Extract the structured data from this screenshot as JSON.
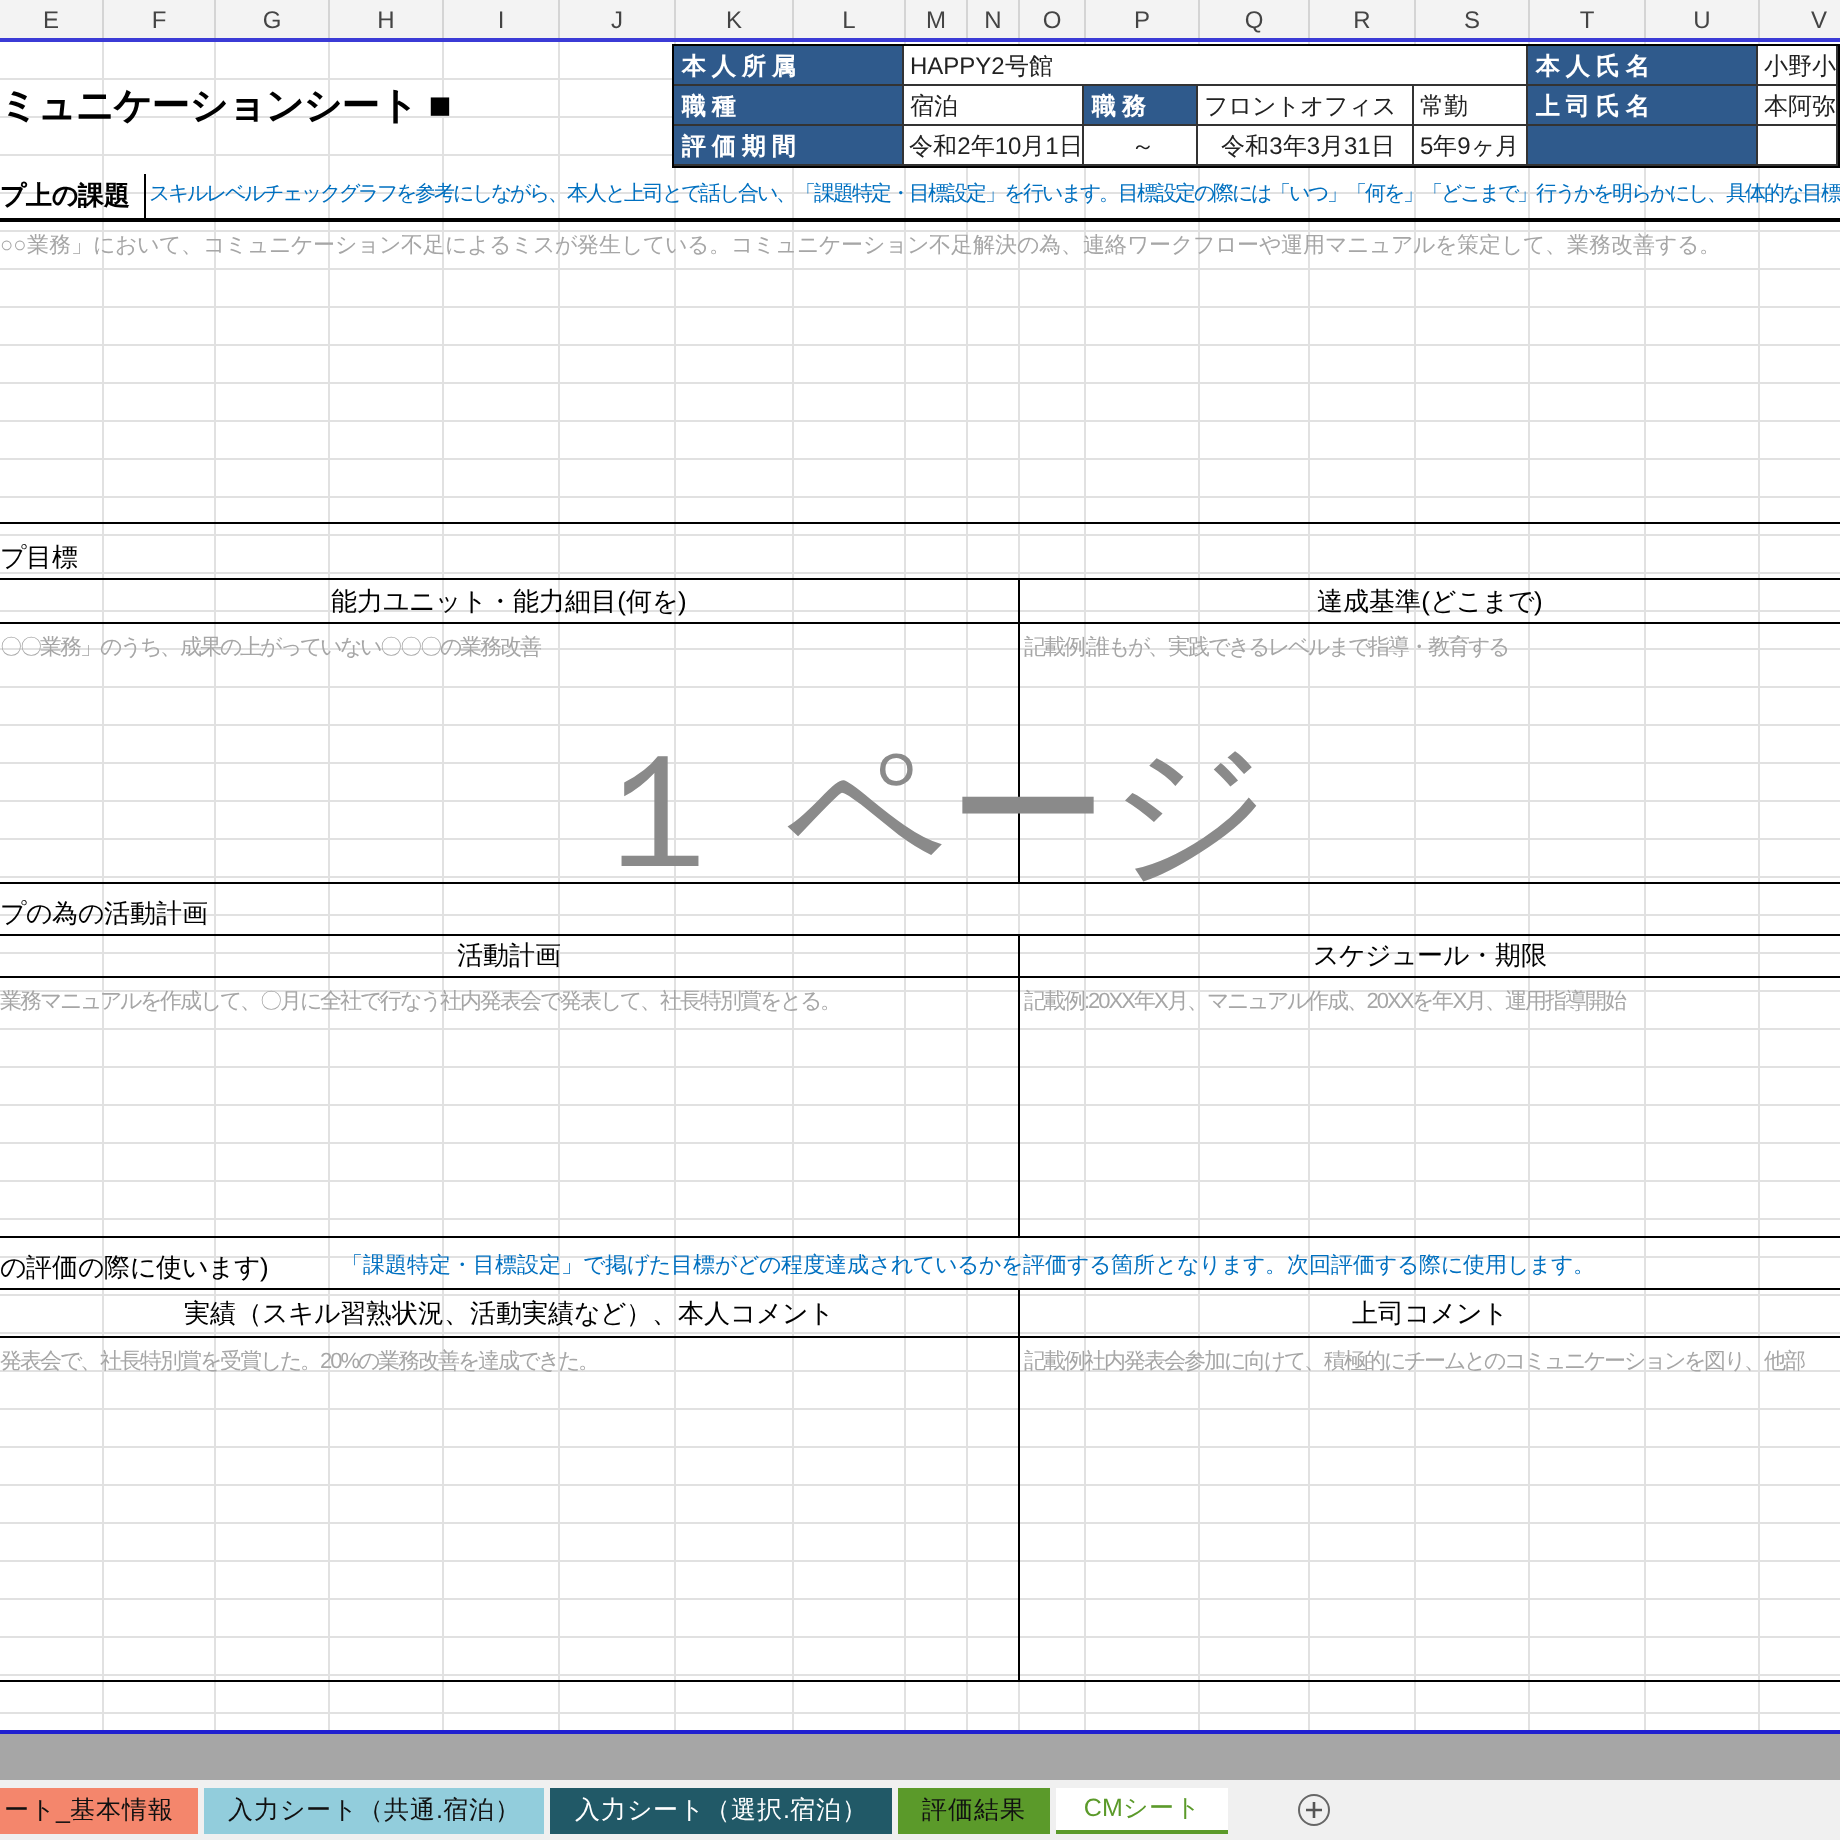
{
  "column_headers": [
    "E",
    "F",
    "G",
    "H",
    "I",
    "J",
    "K",
    "L",
    "M",
    "N",
    "O",
    "P",
    "Q",
    "R",
    "S",
    "T",
    "U",
    "V"
  ],
  "title": "ミュニケーションシート ■",
  "info_table": [
    {
      "cells": [
        {
          "kind": "label",
          "text": "本人所属"
        },
        {
          "kind": "value",
          "text": "HAPPY2号館"
        },
        {
          "kind": "label",
          "text": "本人氏名"
        },
        {
          "kind": "value",
          "text": "小野小"
        }
      ]
    },
    {
      "cells": [
        {
          "kind": "label",
          "text": "職種"
        },
        {
          "kind": "value",
          "text": "宿泊"
        },
        {
          "kind": "label",
          "text": "職務"
        },
        {
          "kind": "value",
          "text": "フロントオフィス"
        },
        {
          "kind": "value",
          "text": "常勤"
        },
        {
          "kind": "label",
          "text": "上司氏名"
        },
        {
          "kind": "value",
          "text": "本阿弥"
        }
      ]
    },
    {
      "cells": [
        {
          "kind": "label",
          "text": "評価期間"
        },
        {
          "kind": "value",
          "text": "令和2年10月1日"
        },
        {
          "kind": "value",
          "text": "～"
        },
        {
          "kind": "value",
          "text": "令和3年3月31日"
        },
        {
          "kind": "value",
          "text": "5年9ヶ月"
        },
        {
          "kind": "label"
        },
        {
          "kind": "value"
        }
      ]
    }
  ],
  "sections": [
    {
      "kind": "single",
      "title": "プ上の課題",
      "note": "スキルレベルチェックグラフを参考にしながら、本人と上司とで話し合い、「課題特定・目標設定」を行います。目標設定の際には「いつ」「何を」「どこまで」行うかを明らかにし、具体的な目標",
      "text": "○○業務」において、コミュニケーション不足によるミスが発生している。コミュニケーション不足解決の為、連絡ワークフローや運用マニュアルを策定して、業務改善する。"
    },
    {
      "kind": "split",
      "title": "プ目標",
      "columns": [
        {
          "heading": "能力ユニット・能力細目(何を)",
          "text": "〇〇業務」のうち、成果の上がっていない〇〇〇の業務改善"
        },
        {
          "heading": "達成基準(どこまで)",
          "text": "記載例:誰もが、実践できるレベルまで指導・教育する"
        }
      ]
    },
    {
      "kind": "split",
      "title": "プの為の活動計画",
      "columns": [
        {
          "heading": "活動計画",
          "text": "業務マニュアルを作成して、〇月に全社で行なう社内発表会で発表して、社長特別賞をとる。"
        },
        {
          "heading": "スケジュール・期限",
          "text": "記載例:20XX年X月、マニュアル作成、20XXを年X月、運用指導開始"
        }
      ]
    },
    {
      "kind": "split",
      "title": "の評価の際に使います)",
      "note": "「課題特定・目標設定」で掲げた目標がどの程度達成されているかを評価する箇所となります。次回評価する際に使用します。",
      "columns": [
        {
          "heading": "実績（スキル習熟状況、活動実績など）、本人コメント",
          "text": "発表会で、社長特別賞を受賞した。20%の業務改善を達成できた。"
        },
        {
          "heading": "上司コメント",
          "text": "記載例社内発表会参加に向けて、積極的にチームとのコミュニケーションを図り、他部"
        }
      ]
    }
  ],
  "page_label": "１ ページ",
  "sheet_tabs": [
    {
      "label": "ート_基本情報",
      "color": "#f4866c",
      "selected": false
    },
    {
      "label": "入力シート（共通.宿泊）",
      "color": "#92cddc",
      "selected": false
    },
    {
      "label": "入力シート（選択.宿泊）",
      "color": "#215967",
      "selected": false
    },
    {
      "label": "評価結果",
      "color": "#5b9a2a",
      "selected": false
    },
    {
      "label": "CMシート",
      "color": "#5b9a2a",
      "selected": true
    }
  ]
}
